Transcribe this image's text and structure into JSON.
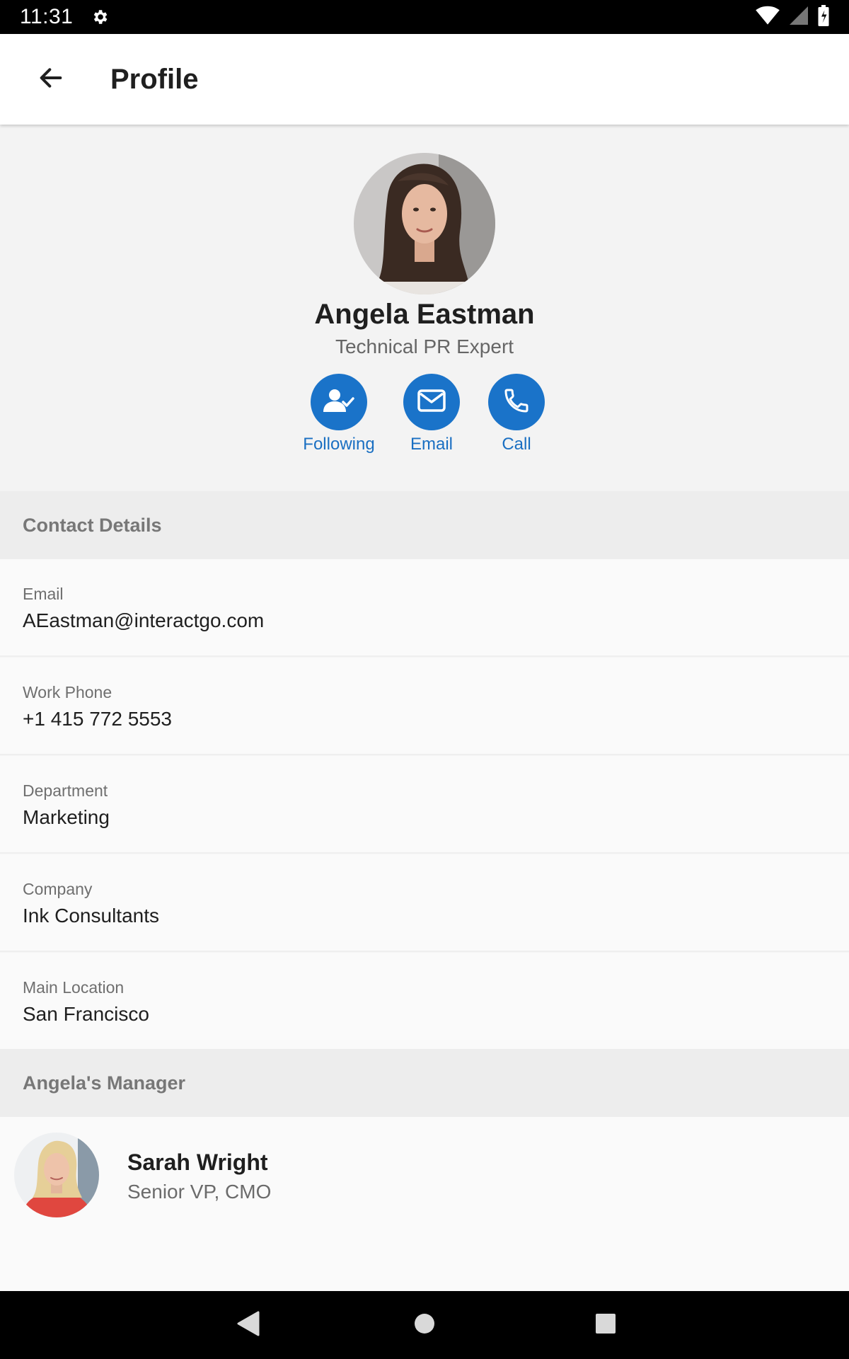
{
  "status_bar": {
    "time": "11:31"
  },
  "app_bar": {
    "title": "Profile"
  },
  "profile": {
    "name": "Angela Eastman",
    "job_title": "Technical PR Expert",
    "actions": [
      {
        "label": "Following",
        "icon": "user-check-icon"
      },
      {
        "label": "Email",
        "icon": "envelope-icon"
      },
      {
        "label": "Call",
        "icon": "phone-icon"
      }
    ]
  },
  "contact_section": {
    "header": "Contact Details",
    "rows": [
      {
        "label": "Email",
        "value": "AEastman@interactgo.com"
      },
      {
        "label": "Work Phone",
        "value": "+1 415 772 5553"
      },
      {
        "label": "Department",
        "value": "Marketing"
      },
      {
        "label": "Company",
        "value": "Ink Consultants"
      },
      {
        "label": "Main Location",
        "value": "San Francisco"
      }
    ]
  },
  "manager_section": {
    "header": "Angela's Manager",
    "name": "Sarah Wright",
    "title": "Senior VP, CMO"
  },
  "colors": {
    "accent": "#1a73c9",
    "accent_text": "#1a6fc2"
  }
}
